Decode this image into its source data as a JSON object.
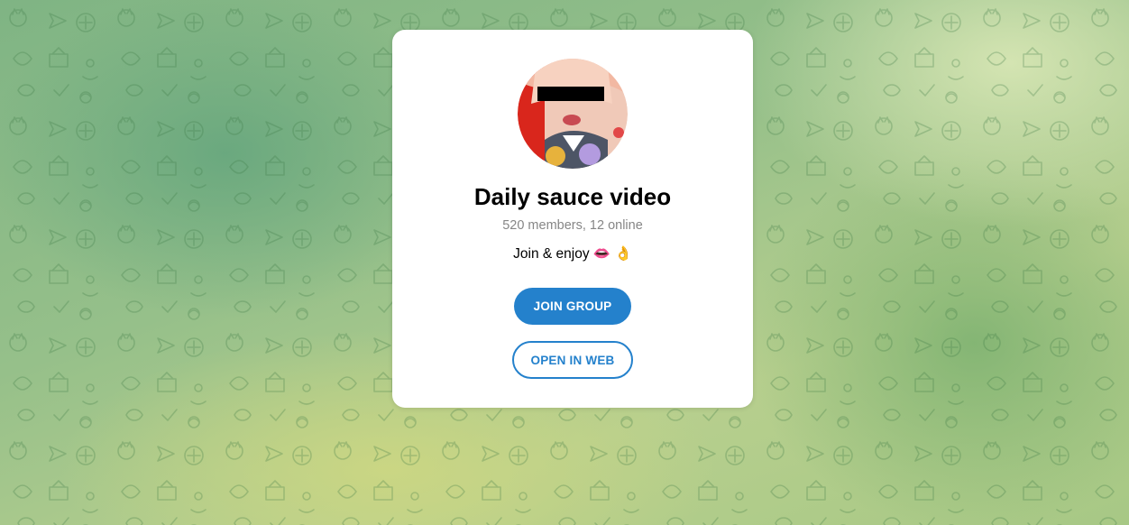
{
  "group": {
    "name": "Daily sauce video",
    "members_text": "520 members, 12 online",
    "description": "Join & enjoy 👄 👌"
  },
  "buttons": {
    "join_label": "JOIN GROUP",
    "web_label": "OPEN IN WEB"
  },
  "colors": {
    "accent": "#2481cc",
    "subtitle": "#868686",
    "card": "#ffffff"
  },
  "icons": {
    "avatar": "group-avatar-image"
  }
}
